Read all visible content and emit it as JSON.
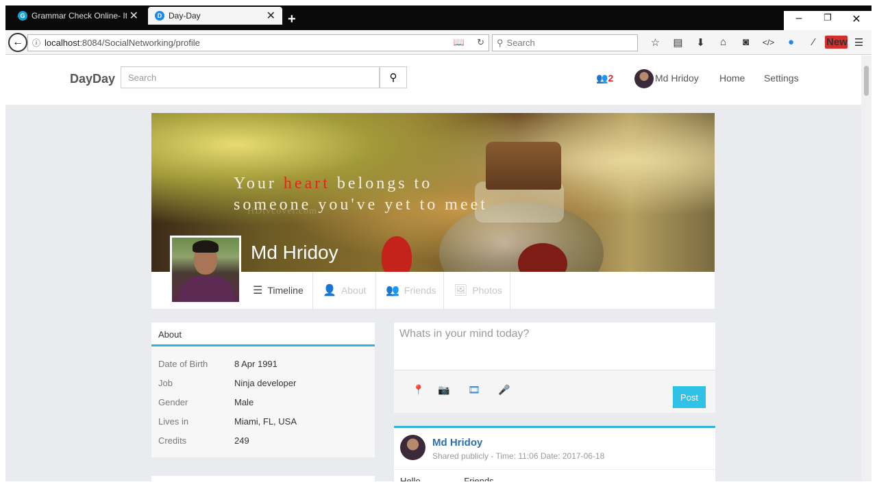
{
  "browser": {
    "tabs": [
      {
        "title": "Grammar Check Online- It's",
        "favicon": "G",
        "favicon_color": "#15a0d8"
      },
      {
        "title": "Day-Day",
        "favicon": "D",
        "favicon_color": "#1e88e5"
      }
    ],
    "url_host": "localhost",
    "url_rest": ":8084/SocialNetworking/profile",
    "search_placeholder": "Search",
    "new_badge": "New"
  },
  "site": {
    "brand": "DayDay",
    "search_placeholder": "Search",
    "friend_requests": "2",
    "user_name": "Md Hridoy",
    "nav": [
      "Home",
      "Settings"
    ]
  },
  "cover": {
    "quote_a": "Your ",
    "quote_highlight": "heart",
    "quote_b": " belongs to",
    "quote_line2": "someone you've yet to meet",
    "watermark": "HDtvcover.com",
    "profile_name": "Md Hridoy"
  },
  "profile_tabs": [
    {
      "label": "Timeline",
      "icon": "menu-icon"
    },
    {
      "label": "About",
      "icon": "user-icon"
    },
    {
      "label": "Friends",
      "icon": "users-icon"
    },
    {
      "label": "Photos",
      "icon": "picture-icon"
    }
  ],
  "about": {
    "title": "About",
    "rows": [
      {
        "key": "Date of Birth",
        "value": "8 Apr 1991"
      },
      {
        "key": "Job",
        "value": "Ninja developer"
      },
      {
        "key": "Gender",
        "value": "Male"
      },
      {
        "key": "Lives in",
        "value": "Miami, FL, USA"
      },
      {
        "key": "Credits",
        "value": "249"
      }
    ]
  },
  "composer": {
    "placeholder": "Whats in your mind today?",
    "post_label": "Post"
  },
  "post": {
    "author": "Md Hridoy",
    "meta": "Shared publicly -  Time: 11:06  Date:  2017-06-18",
    "body": "Hello Friends"
  },
  "colors": {
    "accent": "#2fb4de",
    "link": "#2b6fb0",
    "alert": "#d9232d"
  }
}
